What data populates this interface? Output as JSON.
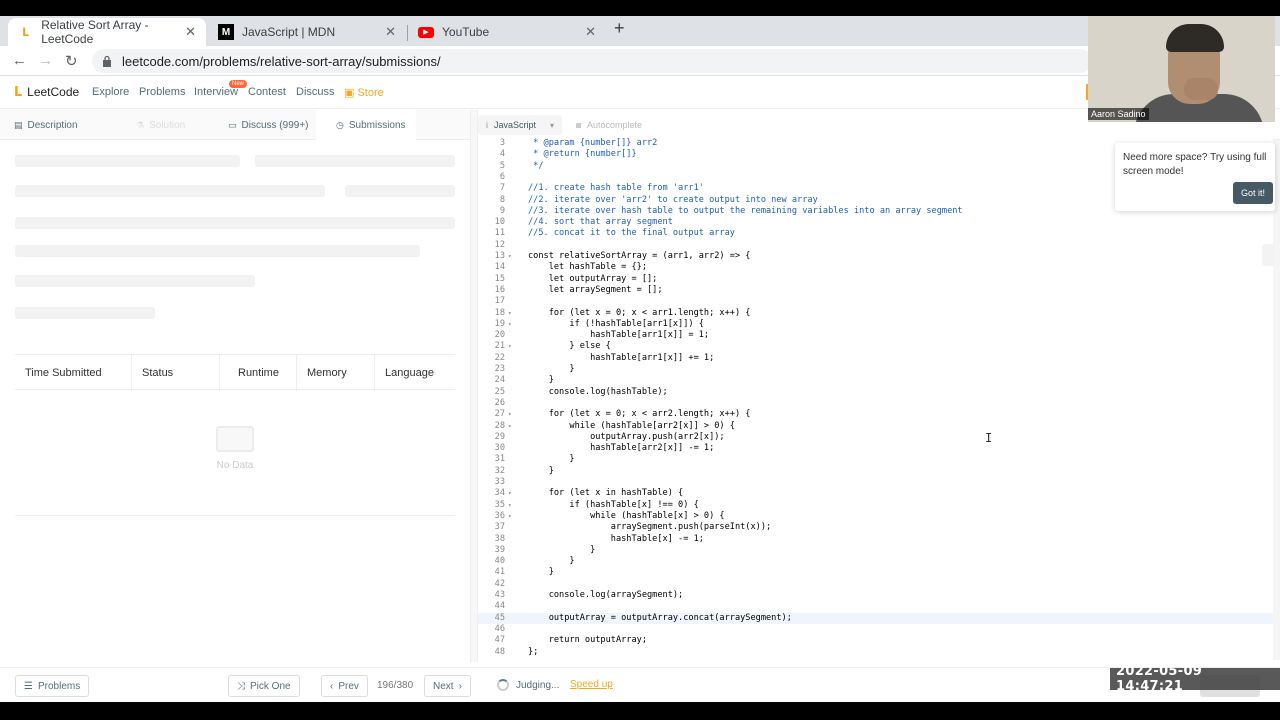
{
  "browser": {
    "tabs": [
      {
        "title": "Relative Sort Array - LeetCode",
        "favicon": "leetcode-icon",
        "active": true
      },
      {
        "title": "JavaScript | MDN",
        "favicon": "mdn-icon",
        "active": false
      },
      {
        "title": "YouTube",
        "favicon": "youtube-icon",
        "active": false
      }
    ],
    "url": "leetcode.com/problems/relative-sort-array/submissions/"
  },
  "nav": {
    "logo": "LeetCode",
    "links": [
      "Explore",
      "Problems",
      "Interview",
      "Contest",
      "Discuss",
      "Store"
    ],
    "new_badge": "New"
  },
  "panel_tabs": [
    "Description",
    "Solution",
    "Discuss (999+)",
    "Submissions"
  ],
  "submissions_table": {
    "headers": [
      "Time Submitted",
      "Status",
      "Runtime",
      "Memory",
      "Language"
    ],
    "empty_text": "No Data"
  },
  "editor": {
    "language": "JavaScript",
    "autocomplete_label": "Autocomplete",
    "lines": [
      {
        "n": "3",
        "text": " * @param {number[]} arr2",
        "cls": "cmt"
      },
      {
        "n": "4",
        "text": " * @return {number[]}",
        "cls": "cmt"
      },
      {
        "n": "5",
        "text": " */",
        "cls": "cmt"
      },
      {
        "n": "6",
        "text": ""
      },
      {
        "n": "7",
        "text": "//1. create hash table from 'arr1'",
        "cls": "cmt"
      },
      {
        "n": "8",
        "text": "//2. iterate over 'arr2' to create output into new array",
        "cls": "cmt"
      },
      {
        "n": "9",
        "text": "//3. iterate over hash table to output the remaining variables into an array segment",
        "cls": "cmt"
      },
      {
        "n": "10",
        "text": "//4. sort that array segment",
        "cls": "cmt"
      },
      {
        "n": "11",
        "text": "//5. concat it to the final output array",
        "cls": "cmt"
      },
      {
        "n": "12",
        "text": ""
      },
      {
        "n": "13",
        "text": "const relativeSortArray = (arr1, arr2) => {",
        "fold": true
      },
      {
        "n": "14",
        "text": "    let hashTable = {};"
      },
      {
        "n": "15",
        "text": "    let outputArray = [];"
      },
      {
        "n": "16",
        "text": "    let arraySegment = [];"
      },
      {
        "n": "17",
        "text": ""
      },
      {
        "n": "18",
        "text": "    for (let x = 0; x < arr1.length; x++) {",
        "fold": true
      },
      {
        "n": "19",
        "text": "        if (!hashTable[arr1[x]]) {",
        "fold": true
      },
      {
        "n": "20",
        "text": "            hashTable[arr1[x]] = 1;"
      },
      {
        "n": "21",
        "text": "        } else {",
        "fold": true
      },
      {
        "n": "22",
        "text": "            hashTable[arr1[x]] += 1;"
      },
      {
        "n": "23",
        "text": "        }"
      },
      {
        "n": "24",
        "text": "    }"
      },
      {
        "n": "25",
        "text": "    console.log(hashTable);"
      },
      {
        "n": "26",
        "text": ""
      },
      {
        "n": "27",
        "text": "    for (let x = 0; x < arr2.length; x++) {",
        "fold": true
      },
      {
        "n": "28",
        "text": "        while (hashTable[arr2[x]] > 0) {",
        "fold": true
      },
      {
        "n": "29",
        "text": "            outputArray.push(arr2[x]);"
      },
      {
        "n": "30",
        "text": "            hashTable[arr2[x]] -= 1;"
      },
      {
        "n": "31",
        "text": "        }"
      },
      {
        "n": "32",
        "text": "    }"
      },
      {
        "n": "33",
        "text": ""
      },
      {
        "n": "34",
        "text": "    for (let x in hashTable) {",
        "fold": true
      },
      {
        "n": "35",
        "text": "        if (hashTable[x] !== 0) {",
        "fold": true
      },
      {
        "n": "36",
        "text": "            while (hashTable[x] > 0) {",
        "fold": true
      },
      {
        "n": "37",
        "text": "                arraySegment.push(parseInt(x));"
      },
      {
        "n": "38",
        "text": "                hashTable[x] -= 1;"
      },
      {
        "n": "39",
        "text": "            }"
      },
      {
        "n": "40",
        "text": "        }"
      },
      {
        "n": "41",
        "text": "    }"
      },
      {
        "n": "42",
        "text": ""
      },
      {
        "n": "43",
        "text": "    console.log(arraySegment);"
      },
      {
        "n": "44",
        "text": ""
      },
      {
        "n": "45",
        "text": "    outputArray = outputArray.concat(arraySegment);",
        "hl": true
      },
      {
        "n": "46",
        "text": ""
      },
      {
        "n": "47",
        "text": "    return outputArray;"
      },
      {
        "n": "48",
        "text": "};"
      }
    ]
  },
  "bottom": {
    "problems_label": "Problems",
    "pick_one_label": "Pick One",
    "prev_label": "Prev",
    "next_label": "Next",
    "page_count": "196/380",
    "judging_label": "Judging...",
    "speed_up_label": "Speed up"
  },
  "tooltip": {
    "text": "Need more space? Try using full screen mode!",
    "button": "Got it!"
  },
  "webcam": {
    "name": "Aaron Sadino"
  },
  "timestamp": "2022-05-09  14:47:21"
}
